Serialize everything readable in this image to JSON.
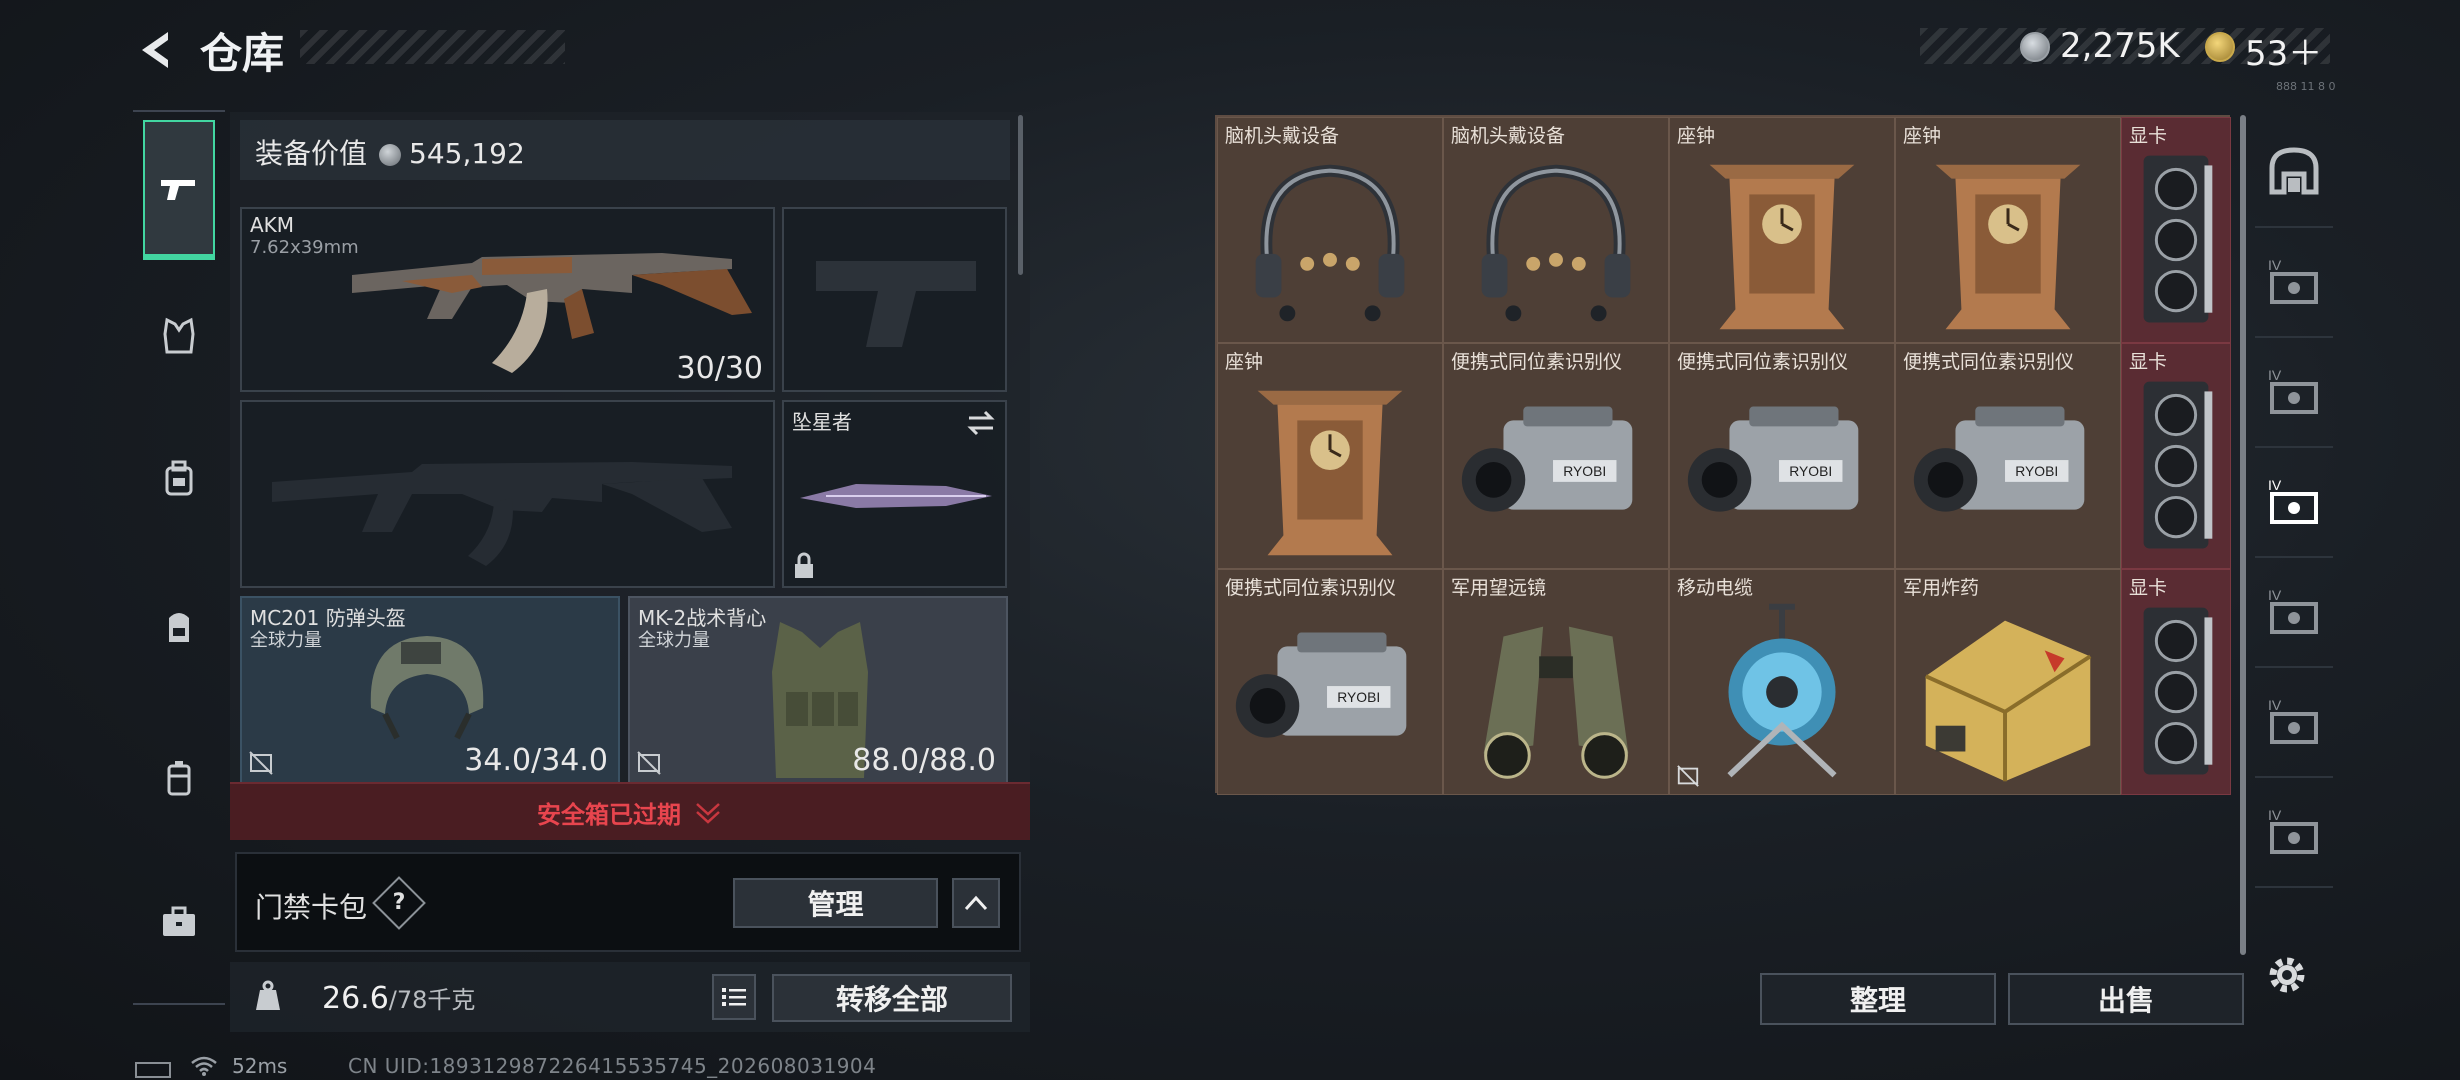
{
  "header": {
    "title": "仓库",
    "currency_silver": "2,275K",
    "currency_gold": "53＋",
    "version_tag": "888 11 8 0"
  },
  "equipment": {
    "value_label": "装备价值",
    "value": "545,192",
    "primary_weapon": {
      "name": "AKM",
      "ammo": "7.62x39mm",
      "count": "30/30"
    },
    "melee": {
      "name": "坠星者"
    },
    "helmet": {
      "name": "MC201 防弹头盔",
      "brand": "全球力量",
      "durability": "34.0/34.0"
    },
    "armor": {
      "name": "MK-2战术背心",
      "brand": "全球力量",
      "durability": "88.0/88.0"
    },
    "safe_box_status": "安全箱已过期",
    "keycard_label": "门禁卡包",
    "keycard_help": "?",
    "manage_label": "管理",
    "weight_current": "26.6",
    "weight_capacity": "/78千克",
    "transfer_all_label": "转移全部"
  },
  "storage": {
    "cells": [
      {
        "name": "脑机头戴设备",
        "icon": "headset-icon"
      },
      {
        "name": "脑机头戴设备",
        "icon": "headset-icon"
      },
      {
        "name": "座钟",
        "icon": "clock-icon"
      },
      {
        "name": "座钟",
        "icon": "clock-icon"
      },
      {
        "name": "显卡",
        "icon": "gpu-icon"
      },
      {
        "name": "座钟",
        "icon": "clock-icon"
      },
      {
        "name": "便携式同位素识别仪",
        "icon": "isotope-scanner-icon"
      },
      {
        "name": "便携式同位素识别仪",
        "icon": "isotope-scanner-icon"
      },
      {
        "name": "便携式同位素识别仪",
        "icon": "isotope-scanner-icon"
      },
      {
        "name": "显卡",
        "icon": "gpu-icon"
      },
      {
        "name": "便携式同位素识别仪",
        "icon": "isotope-scanner-icon"
      },
      {
        "name": "军用望远镜",
        "icon": "binoculars-icon"
      },
      {
        "name": "移动电缆",
        "icon": "cable-reel-icon"
      },
      {
        "name": "军用炸药",
        "icon": "explosive-crate-icon"
      },
      {
        "name": "显卡",
        "icon": "gpu-icon"
      }
    ],
    "sort_label": "整理",
    "sell_label": "出售"
  },
  "status_bar": {
    "ping": "52ms",
    "uid": "CN UID:1893129872264155357​45_202608031904"
  },
  "colors": {
    "accent": "#42d6a1",
    "warning": "#e8454e",
    "storage_bg": "#4e3f36",
    "rare_bg": "#5a2c33"
  }
}
